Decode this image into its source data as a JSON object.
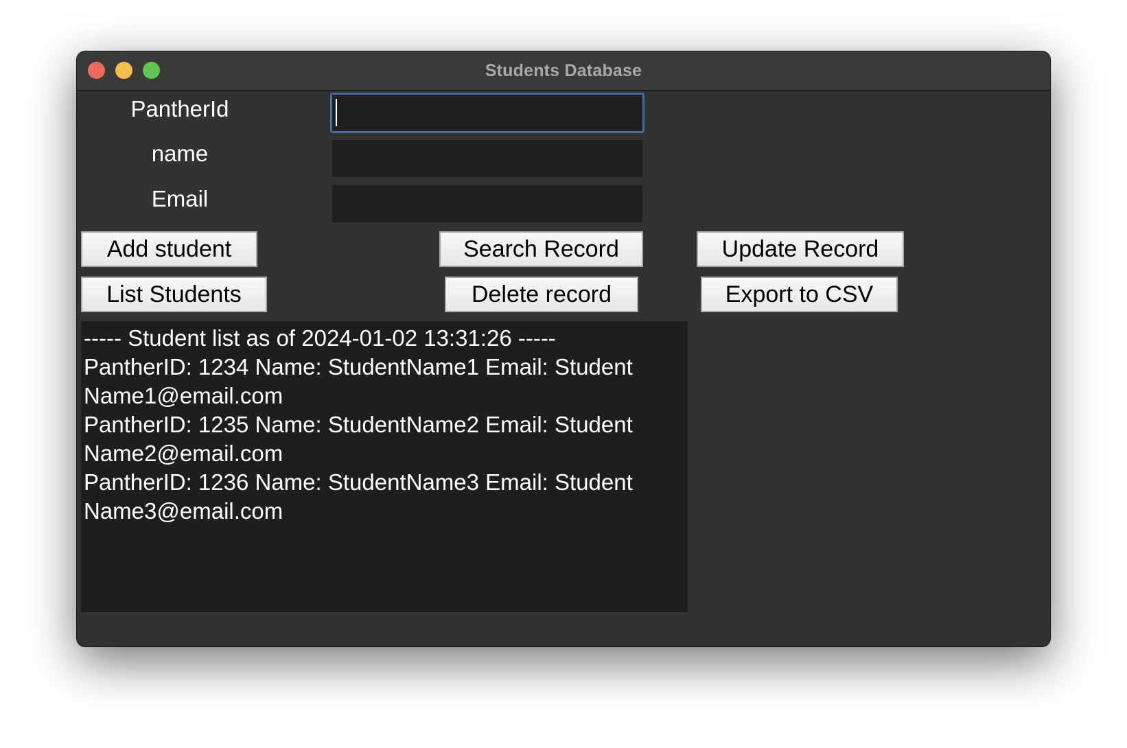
{
  "window": {
    "title": "Students Database",
    "traffic_lights": {
      "close": "#ed6a5e",
      "minimize": "#f5bf4f",
      "maximize": "#61c554"
    }
  },
  "form": {
    "pantherid_label": "PantherId",
    "pantherid_value": "",
    "name_label": "name",
    "name_value": "",
    "email_label": "Email",
    "email_value": ""
  },
  "buttons": {
    "add_student": "Add student",
    "search_record": "Search Record",
    "update_record": "Update Record",
    "list_students": "List Students",
    "delete_record": "Delete record",
    "export_csv": "Export to CSV"
  },
  "output": {
    "lines": [
      "----- Student list as of 2024-01-02 13:31:26 -----",
      "PantherID: 1234 Name: StudentName1 Email: Student",
      "Name1@email.com",
      "PantherID: 1235 Name: StudentName2 Email: Student",
      "Name2@email.com",
      "PantherID: 1236 Name: StudentName3 Email: Student",
      "Name3@email.com"
    ]
  },
  "colors": {
    "focus_border": "#4a6ba0",
    "window_bg": "#323232",
    "field_bg": "#1f1f1f"
  }
}
